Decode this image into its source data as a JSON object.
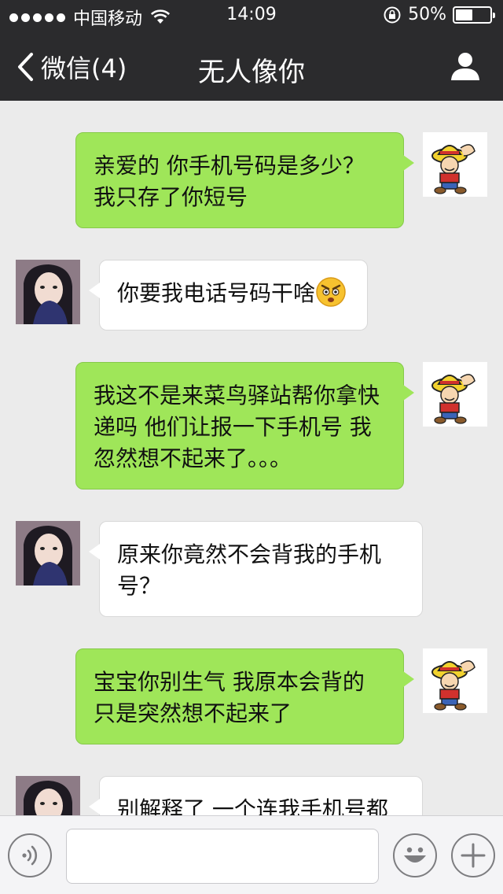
{
  "status_bar": {
    "carrier": "中国移动",
    "time": "14:09",
    "battery": "50%",
    "battery_level": 0.5
  },
  "nav": {
    "back_label": "微信(4)",
    "title": "无人像你",
    "back_icon": "chevron-left-icon",
    "profile_icon": "person-icon"
  },
  "messages": [
    {
      "side": "out",
      "text": "亲爱的 你手机号码是多少？我只存了你短号"
    },
    {
      "side": "in",
      "text": "你要我电话号码干啥",
      "emoji": "angry-face-emoji"
    },
    {
      "side": "out",
      "text": "我这不是来菜鸟驿站帮你拿快递吗 他们让报一下手机号 我忽然想不起来了。。。"
    },
    {
      "side": "in",
      "text": "原来你竟然不会背我的手机号？"
    },
    {
      "side": "out",
      "text": "宝宝你别生气 我原本会背的只是突然想不起来了"
    },
    {
      "side": "in",
      "text": "别解释了 一个连我手机号都"
    }
  ],
  "input_bar": {
    "value": "",
    "voice_icon": "voice-icon",
    "emoji_icon": "emoji-icon",
    "plus_icon": "plus-icon"
  },
  "colors": {
    "bar_bg": "#2b2b2d",
    "chat_bg": "#ebebeb",
    "out_bubble": "#9fe659",
    "in_bubble": "#ffffff"
  }
}
